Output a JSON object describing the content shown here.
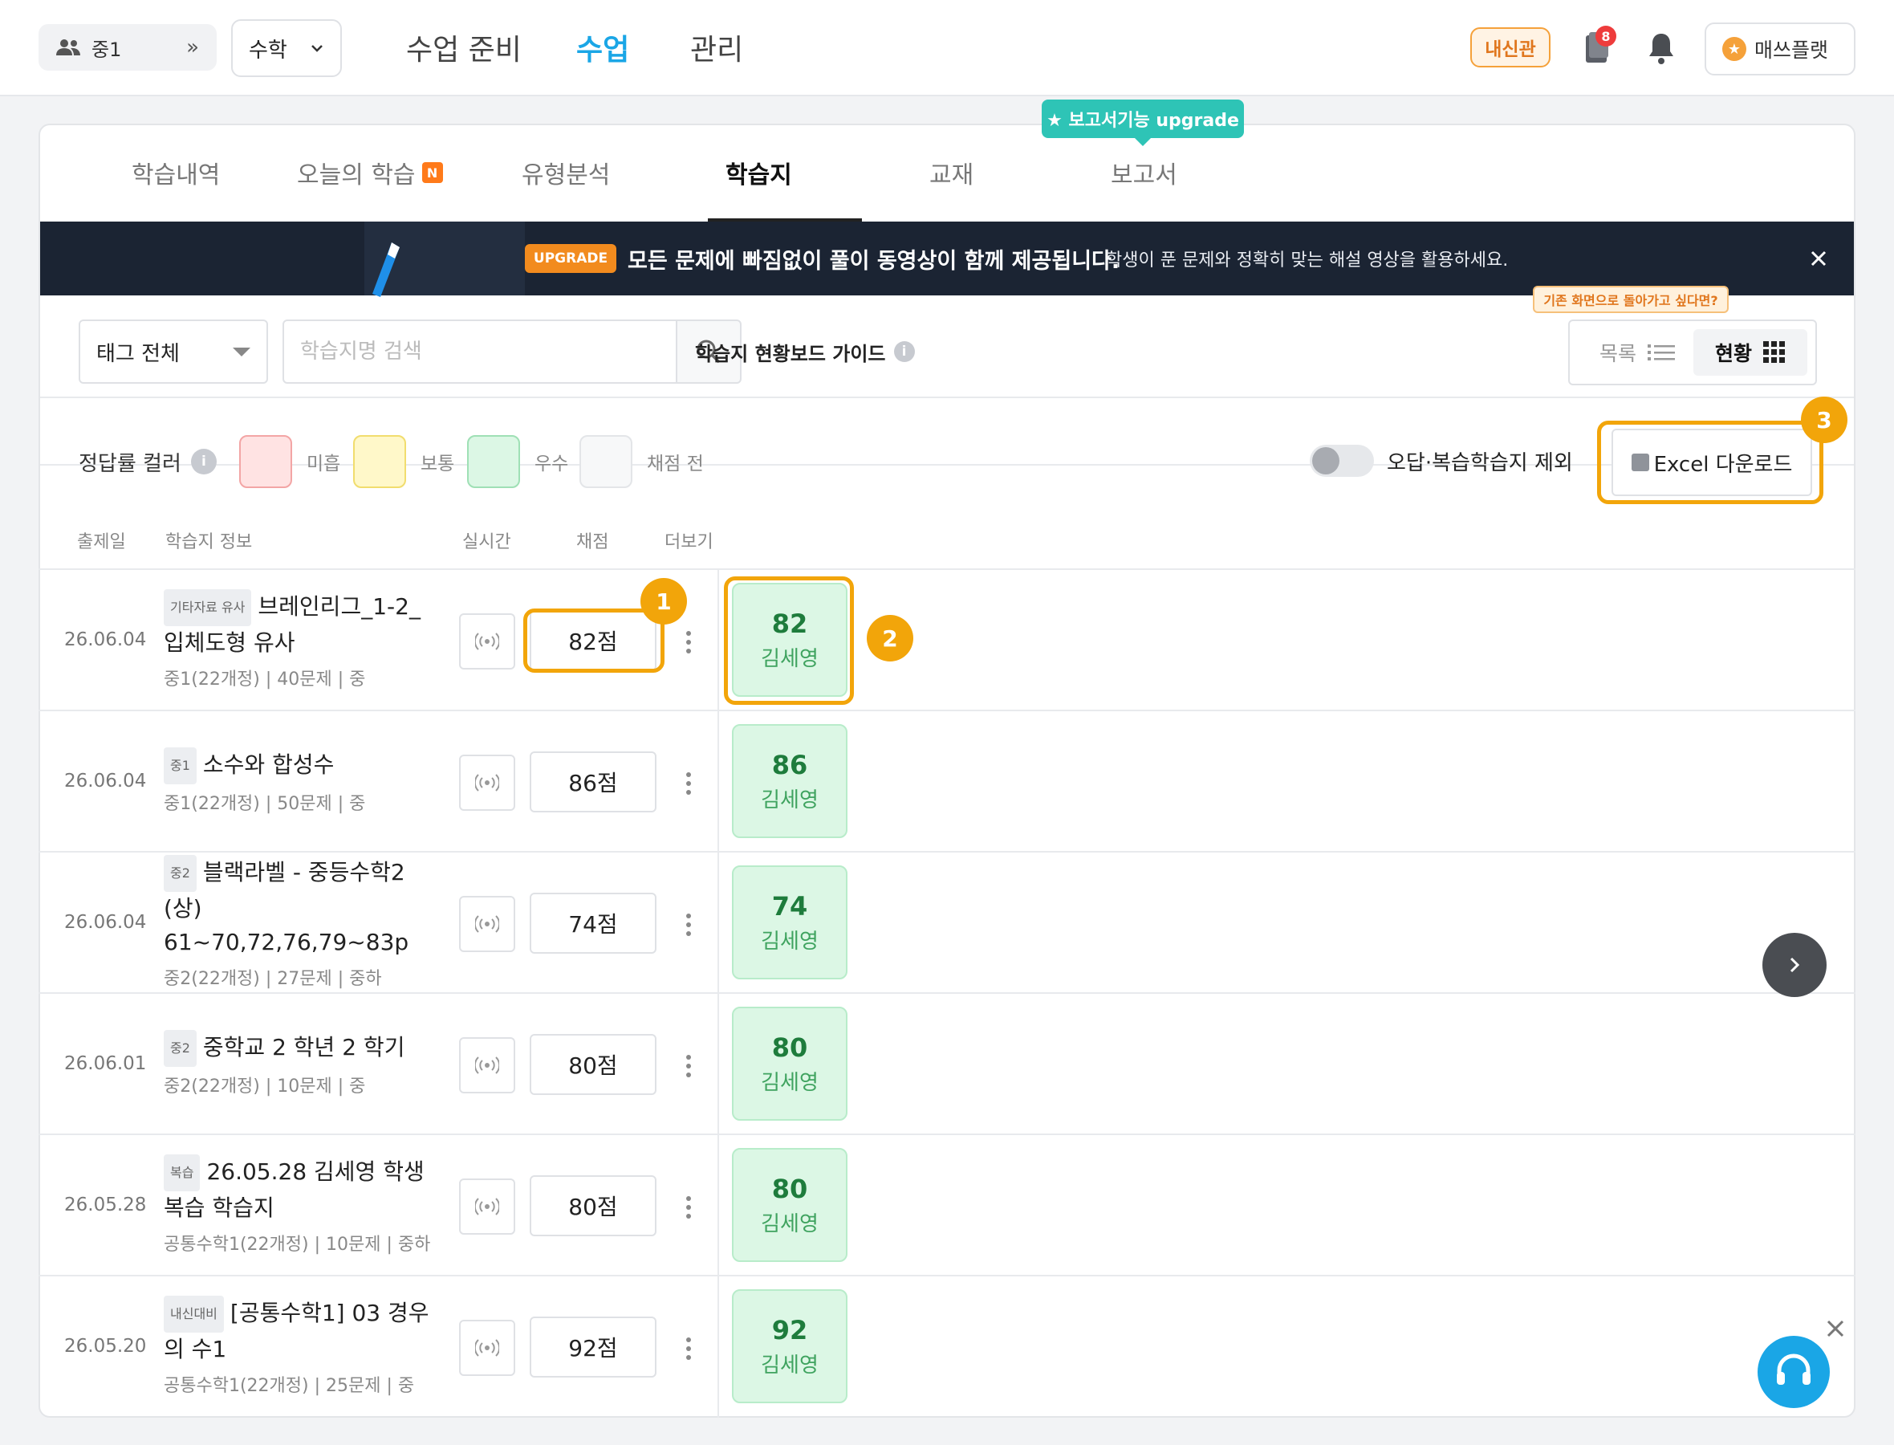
{
  "topbar": {
    "grade": "중1",
    "subject": "수학",
    "nav": [
      "수업 준비",
      "수업",
      "관리"
    ],
    "active_nav": "수업",
    "naesin_label": "내신관",
    "notification_count": "8",
    "plan_label": "매쓰플랫"
  },
  "subtabs": {
    "items": [
      "학습내역",
      "오늘의 학습",
      "유형분석",
      "학습지",
      "교재",
      "보고서"
    ],
    "new_badge": "N",
    "active": "학습지",
    "report_tooltip": "★ 보고서기능 upgrade"
  },
  "banner": {
    "tag": "UPGRADE",
    "main": "모든 문제에 빠짐없이 풀이 동영상이 함께 제공됩니다.",
    "sub": "학생이 푼 문제와 정확히 맞는 해설 영상을 활용하세요."
  },
  "filters": {
    "tag_select": "태그 전체",
    "search_placeholder": "학습지명 검색",
    "guide_label": "학습지 현황보드 가이드",
    "return_tip": "기존 화면으로 돌아가고 싶다면?",
    "view_list": "목록",
    "view_status": "현황"
  },
  "legend": {
    "title": "정답률 컬러",
    "items": [
      {
        "label": "미흡",
        "color": "#ffe3e3",
        "border": "#f3a5a5"
      },
      {
        "label": "보통",
        "color": "#fff8c9",
        "border": "#f1dd6e"
      },
      {
        "label": "우수",
        "color": "#dcf7e5",
        "border": "#9fe0b5"
      },
      {
        "label": "채점 전",
        "color": "#f7f8f9",
        "border": "#e3e5e8"
      }
    ],
    "exclude_label": "오답·복습학습지 제외",
    "excel_label": "Excel 다운로드"
  },
  "table": {
    "headers": [
      "출제일",
      "학습지 정보",
      "실시간",
      "채점",
      "더보기"
    ],
    "rows": [
      {
        "date": "26.06.04",
        "tag": "기타자료 유사",
        "title1": "브레인리그_1-2_",
        "title2": "입체도형 유사",
        "meta": "중1(22개정) | 40문제 | 중",
        "score": "82점",
        "chip_score": "82",
        "student": "김세영"
      },
      {
        "date": "26.06.04",
        "tag": "중1",
        "title1": "소수와 합성수",
        "title2": "",
        "meta": "중1(22개정) | 50문제 | 중",
        "score": "86점",
        "chip_score": "86",
        "student": "김세영"
      },
      {
        "date": "26.06.04",
        "tag": "중2",
        "title1": "블랙라벨 - 중등수학2",
        "title2": "(상) 61~70,72,76,79~83p",
        "meta": "중2(22개정) | 27문제 | 중하",
        "score": "74점",
        "chip_score": "74",
        "student": "김세영"
      },
      {
        "date": "26.06.01",
        "tag": "중2",
        "title1": "중학교 2 학년 2 학기",
        "title2": "",
        "meta": "중2(22개정) | 10문제 | 중",
        "score": "80점",
        "chip_score": "80",
        "student": "김세영"
      },
      {
        "date": "26.05.28",
        "tag": "복습",
        "title1": "26.05.28 김세영 학생",
        "title2": "복습 학습지",
        "meta": "공통수학1(22개정) | 10문제 | 중하",
        "score": "80점",
        "chip_score": "80",
        "student": "김세영"
      },
      {
        "date": "26.05.20",
        "tag": "내신대비",
        "title1": "[공통수학1] 03 경우",
        "title2": "의 수1",
        "meta": "공통수학1(22개정) | 25문제 | 중",
        "score": "92점",
        "chip_score": "92",
        "student": "김세영"
      }
    ]
  },
  "callouts": [
    "1",
    "2",
    "3"
  ],
  "colors": {
    "accent": "#1aa6e6",
    "highlight": "#f2a50a",
    "chip_bg": "#dcf7e5",
    "chip_text": "#1e7c3c"
  }
}
